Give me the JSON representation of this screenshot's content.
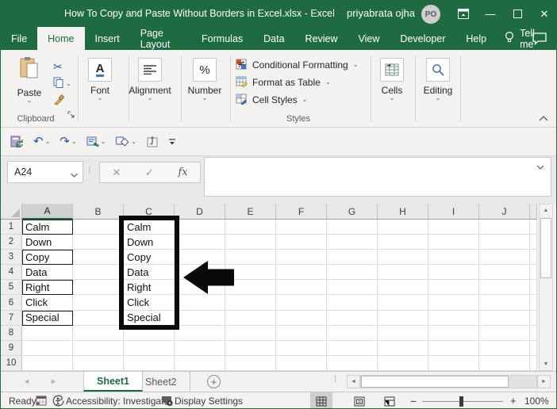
{
  "titlebar": {
    "title": "How To Copy and Paste Without Borders in Excel.xlsx  -  Excel",
    "user": "priyabrata ojha",
    "avatar_initials": "PO"
  },
  "menubar": {
    "tabs": [
      {
        "label": "File",
        "active": false
      },
      {
        "label": "Home",
        "active": true
      },
      {
        "label": "Insert",
        "active": false
      },
      {
        "label": "Page Layout",
        "active": false
      },
      {
        "label": "Formulas",
        "active": false
      },
      {
        "label": "Data",
        "active": false
      },
      {
        "label": "Review",
        "active": false
      },
      {
        "label": "View",
        "active": false
      },
      {
        "label": "Developer",
        "active": false
      },
      {
        "label": "Help",
        "active": false
      }
    ],
    "tell_me": "Tell me"
  },
  "ribbon": {
    "paste_label": "Paste",
    "clipboard_group": "Clipboard",
    "font_group": "Font",
    "font_icon_letter": "A",
    "alignment_group": "Alignment",
    "number_group": "Number",
    "number_icon": "%",
    "styles_group": "Styles",
    "styles_buttons": [
      "Conditional Formatting",
      "Format as Table",
      "Cell Styles"
    ],
    "cells_group": "Cells",
    "editing_group": "Editing"
  },
  "formula_bar": {
    "name_box_value": "A24",
    "fx_label": "fx"
  },
  "grid": {
    "column_headers": [
      "A",
      "B",
      "C",
      "D",
      "E",
      "F",
      "G",
      "H",
      "I",
      "J"
    ],
    "row_headers": [
      "1",
      "2",
      "3",
      "4",
      "5",
      "6",
      "7",
      "8",
      "9",
      "10"
    ],
    "column_a_values": [
      "Calm",
      "Down",
      "Copy",
      "Data",
      "Right",
      "Click",
      "Special"
    ],
    "column_c_values": [
      "Calm",
      "Down",
      "Copy",
      "Data",
      "Right",
      "Click",
      "Special"
    ],
    "selected_column": "A",
    "bordered_a_rows": [
      1,
      3,
      5,
      7
    ]
  },
  "sheet_bar": {
    "tabs": [
      {
        "label": "Sheet1",
        "active": true
      },
      {
        "label": "Sheet2",
        "active": false
      }
    ],
    "add_sheet": "+"
  },
  "status_bar": {
    "mode": "Ready",
    "accessibility": "Accessibility: Investigate",
    "display_settings": "Display Settings",
    "zoom_level": "100%"
  },
  "icons": {
    "chevron_down": "⌄",
    "minimize": "—",
    "maximize": "☐",
    "close": "✕",
    "undo": "↶",
    "redo": "↷",
    "scissors": "✂",
    "up_arrow": "▲",
    "down_arrow": "▼",
    "left_arrow": "◄",
    "right_arrow": "►",
    "grip": "⁞",
    "cancel_x": "✕",
    "enter_check": "✓",
    "minus": "−",
    "plus": "+"
  },
  "colors": {
    "excel_green": "#1E6B41",
    "accent_blue": "#2456a4",
    "annotation_black": "#0a0a0a"
  }
}
